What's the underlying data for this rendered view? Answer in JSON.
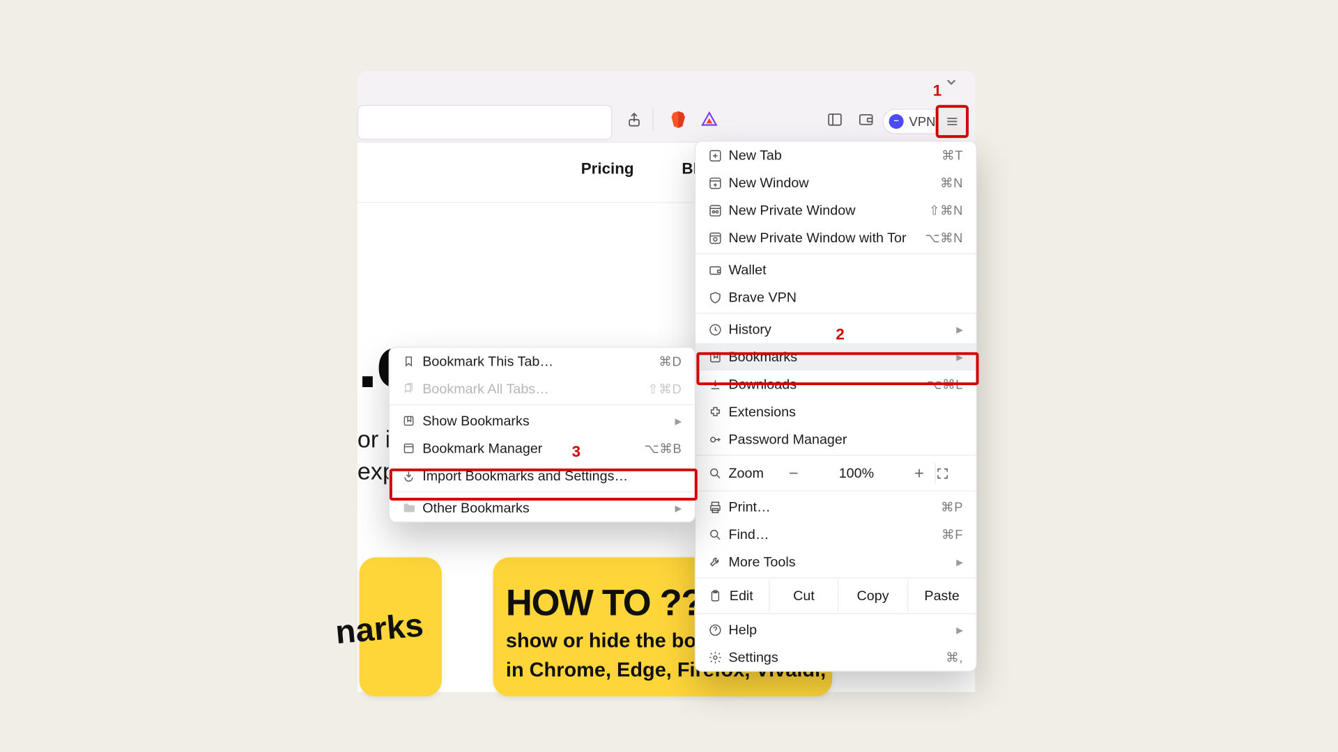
{
  "annotations": {
    "a1": "1",
    "a2": "2",
    "a3": "3"
  },
  "toolbar": {
    "vpn": "VPN"
  },
  "nav": {
    "pricing": "Pricing",
    "blog": "Bl"
  },
  "hero": {
    "frag": ".c",
    "p1": "or in",
    "p2": "exp"
  },
  "card1": {
    "tilt": "narks"
  },
  "card2": {
    "title": "HOW TO ???",
    "line1": "show or hide the boo",
    "line2": "in Chrome, Edge, Firefox, Vivaldi,"
  },
  "menu": {
    "newtab": {
      "l": "New Tab",
      "s": "⌘T"
    },
    "newwin": {
      "l": "New Window",
      "s": "⌘N"
    },
    "newpriv": {
      "l": "New Private Window",
      "s": "⇧⌘N"
    },
    "newtor": {
      "l": "New Private Window with Tor",
      "s": "⌥⌘N"
    },
    "wallet": {
      "l": "Wallet"
    },
    "bvpn": {
      "l": "Brave VPN"
    },
    "history": {
      "l": "History"
    },
    "bookmarks": {
      "l": "Bookmarks"
    },
    "downloads": {
      "l": "Downloads",
      "s": "⌥⌘L"
    },
    "ext": {
      "l": "Extensions"
    },
    "pwd": {
      "l": "Password Manager"
    },
    "zoom": {
      "l": "Zoom",
      "minus": "−",
      "val": "100%",
      "plus": "+"
    },
    "print": {
      "l": "Print…",
      "s": "⌘P"
    },
    "find": {
      "l": "Find…",
      "s": "⌘F"
    },
    "more": {
      "l": "More Tools"
    },
    "edit": {
      "l": "Edit",
      "cut": "Cut",
      "copy": "Copy",
      "paste": "Paste"
    },
    "help": {
      "l": "Help"
    },
    "settings": {
      "l": "Settings",
      "s": "⌘,"
    }
  },
  "submenu": {
    "bmthis": {
      "l": "Bookmark This Tab…",
      "s": "⌘D"
    },
    "bmall": {
      "l": "Bookmark All Tabs…",
      "s": "⇧⌘D"
    },
    "show": {
      "l": "Show Bookmarks"
    },
    "mgr": {
      "l": "Bookmark Manager",
      "s": "⌥⌘B"
    },
    "import": {
      "l": "Import Bookmarks and Settings…"
    },
    "other": {
      "l": "Other Bookmarks"
    }
  }
}
